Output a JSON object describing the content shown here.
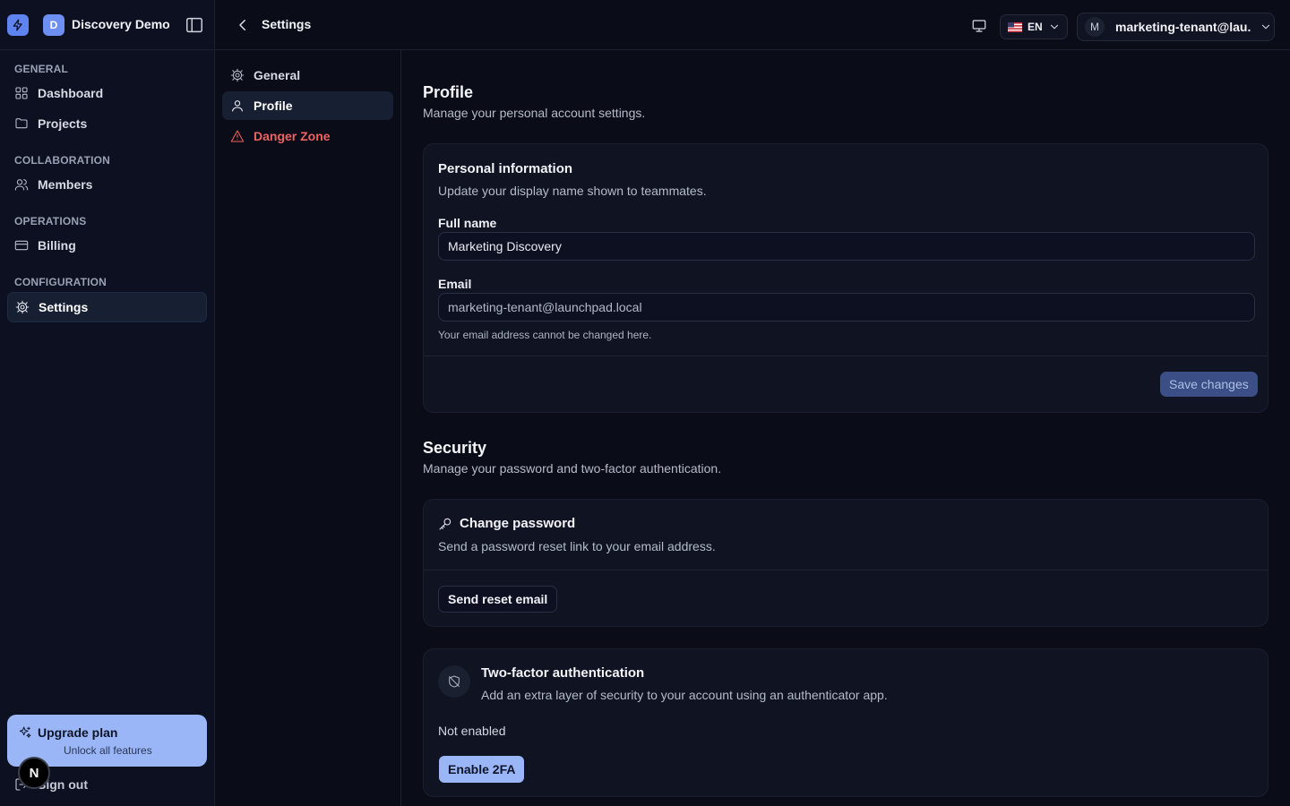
{
  "app": {
    "workspace_initial": "D",
    "workspace_name": "Discovery Demo"
  },
  "sidebar": {
    "groups": [
      {
        "label": "GENERAL",
        "items": [
          {
            "label": "Dashboard",
            "icon": "grid-icon"
          },
          {
            "label": "Projects",
            "icon": "folder-icon"
          }
        ]
      },
      {
        "label": "COLLABORATION",
        "items": [
          {
            "label": "Members",
            "icon": "users-icon"
          }
        ]
      },
      {
        "label": "OPERATIONS",
        "items": [
          {
            "label": "Billing",
            "icon": "credit-card-icon"
          }
        ]
      },
      {
        "label": "CONFIGURATION",
        "items": [
          {
            "label": "Settings",
            "icon": "gear-icon",
            "active": true
          }
        ]
      }
    ],
    "upgrade": {
      "title": "Upgrade plan",
      "subtitle": "Unlock all features"
    },
    "signout_label": "Sign out",
    "floating_badge": "N"
  },
  "topbar": {
    "breadcrumb": "Settings",
    "language": "EN",
    "user_initial": "M",
    "user_email": "marketing-tenant@lau..."
  },
  "subnav": {
    "items": [
      {
        "label": "General",
        "icon": "gear-icon"
      },
      {
        "label": "Profile",
        "icon": "user-icon",
        "active": true
      },
      {
        "label": "Danger Zone",
        "icon": "warning-icon",
        "danger": true
      }
    ]
  },
  "profile": {
    "title": "Profile",
    "subtitle": "Manage your personal account settings.",
    "personal": {
      "title": "Personal information",
      "subtitle": "Update your display name shown to teammates.",
      "full_name_label": "Full name",
      "full_name_value": "Marketing Discovery",
      "email_label": "Email",
      "email_value": "marketing-tenant@launchpad.local",
      "email_hint": "Your email address cannot be changed here.",
      "save_label": "Save changes"
    }
  },
  "security": {
    "title": "Security",
    "subtitle": "Manage your password and two-factor authentication.",
    "password": {
      "title": "Change password",
      "subtitle": "Send a password reset link to your email address.",
      "button": "Send reset email"
    },
    "twofa": {
      "title": "Two-factor authentication",
      "subtitle": "Add an extra layer of security to your account using an authenticator app.",
      "status": "Not enabled",
      "button": "Enable 2FA"
    }
  },
  "colors": {
    "accent": "#9ab6f7",
    "danger": "#f06161",
    "background": "#0a0d17"
  }
}
